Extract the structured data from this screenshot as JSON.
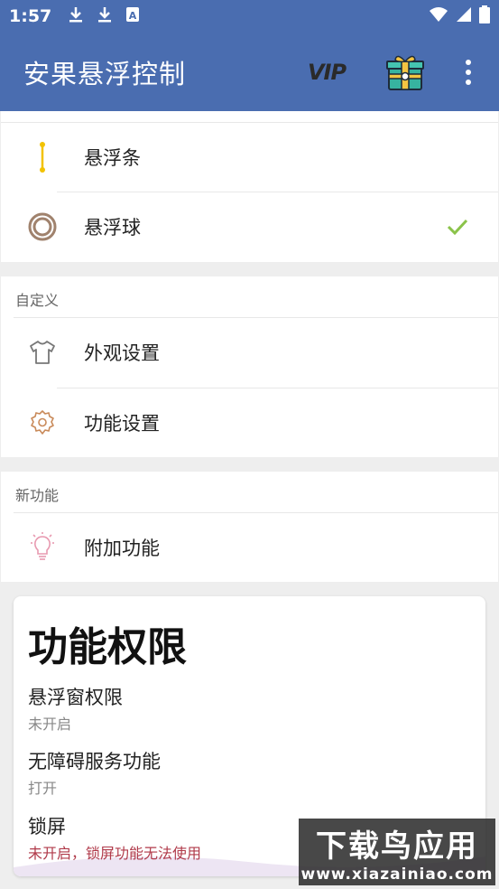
{
  "status_bar": {
    "time": "1:57",
    "left_icons": [
      "download-icon",
      "download-icon",
      "app-store-icon"
    ],
    "right_icons": [
      "wifi-icon",
      "signal-icon",
      "battery-icon"
    ]
  },
  "app_bar": {
    "title": "安果悬浮控制",
    "vip_label": "VIP",
    "gift_icon": "gift-icon",
    "more_icon": "more-vert-icon"
  },
  "mode_list": {
    "items": [
      {
        "label": "悬浮条",
        "icon": "floating-bar-icon",
        "selected": false
      },
      {
        "label": "悬浮球",
        "icon": "floating-ball-icon",
        "selected": true
      }
    ]
  },
  "custom_section": {
    "header": "自定义",
    "items": [
      {
        "label": "外观设置",
        "icon": "tshirt-icon"
      },
      {
        "label": "功能设置",
        "icon": "gear-icon"
      }
    ]
  },
  "new_section": {
    "header": "新功能",
    "items": [
      {
        "label": "附加功能",
        "icon": "lightbulb-icon"
      }
    ]
  },
  "permissions": {
    "title": "功能权限",
    "items": [
      {
        "title": "悬浮窗权限",
        "status": "未开启"
      },
      {
        "title": "无障碍服务功能",
        "status": "打开"
      },
      {
        "title": "锁屏",
        "status": "未开启，锁屏功能无法使用"
      }
    ]
  },
  "watermark": {
    "main": "下载鸟应用",
    "sub": "www.xiazainiao.com"
  },
  "colors": {
    "app_bar": "#4a6db0",
    "check": "#8bc34a",
    "warn": "#b03a4a",
    "floating_bar": "#f2c200",
    "floating_ball": "#a0826d",
    "gear": "#c98a5a",
    "lightbulb": "#e89ab0"
  }
}
